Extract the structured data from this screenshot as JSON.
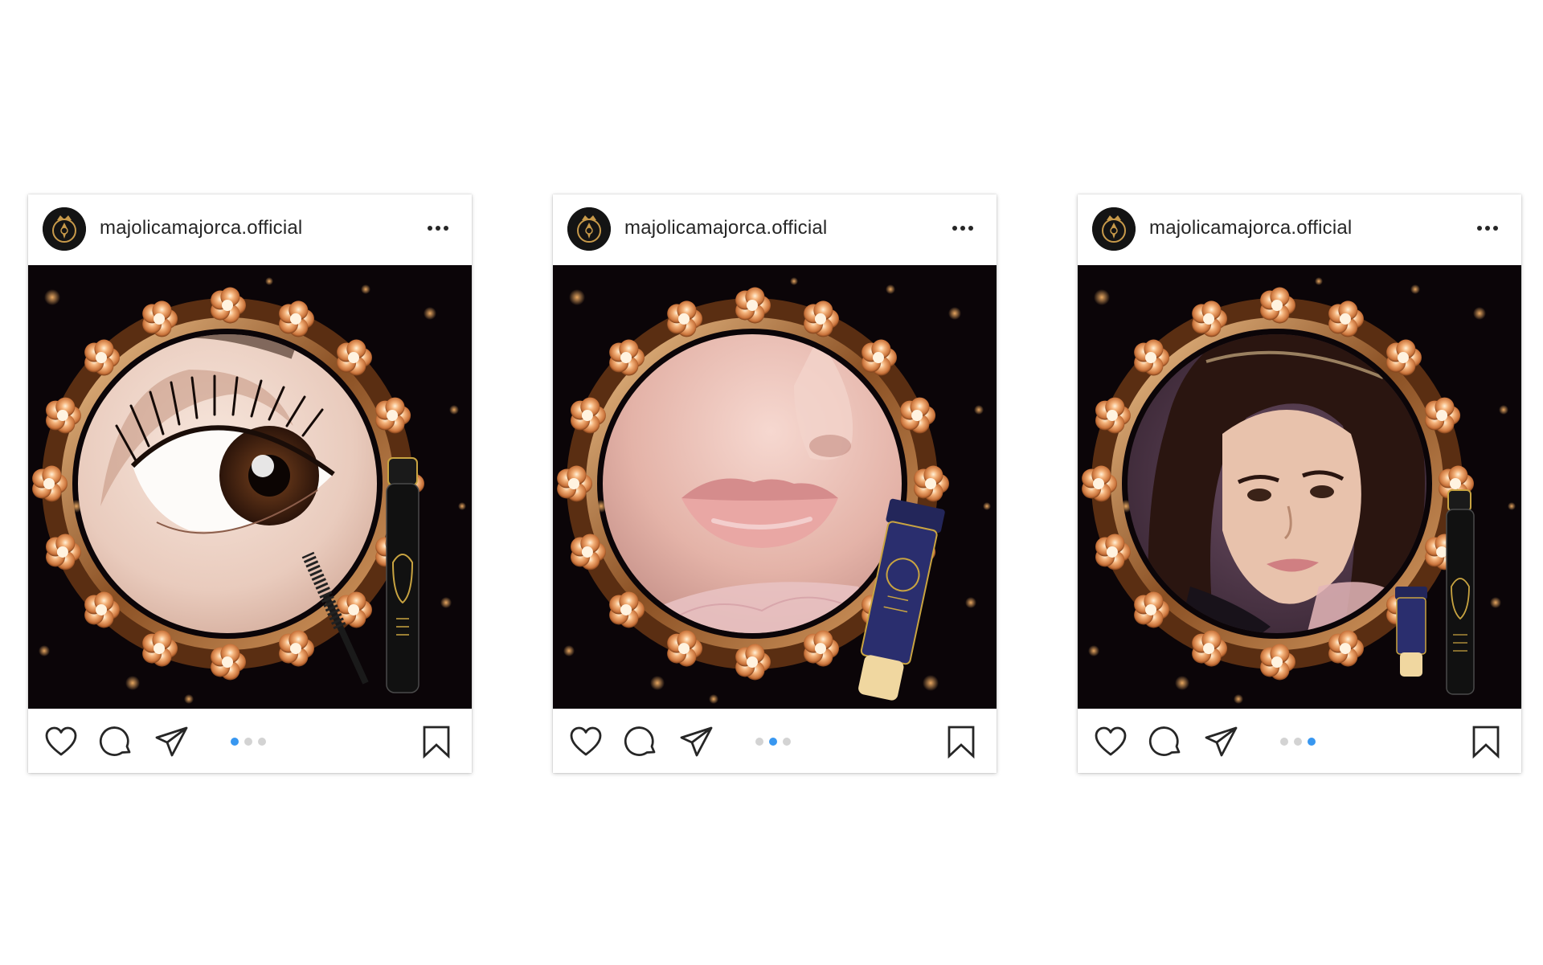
{
  "colors": {
    "active_dot": "#3897f0",
    "inactive_dot": "#d3d3d3",
    "frame_gold": "#d9955b",
    "photo_bg": "#0b0508"
  },
  "posts": [
    {
      "username": "majolicamajorca.official",
      "icons": [
        "brand-crest-icon",
        "more-options-icon",
        "heart-icon",
        "comment-icon",
        "share-icon",
        "bookmark-icon"
      ],
      "carousel": {
        "current": 1,
        "total": 3
      },
      "photo": {
        "subject": "eye-closeup",
        "product": "mascara"
      }
    },
    {
      "username": "majolicamajorca.official",
      "icons": [
        "brand-crest-icon",
        "more-options-icon",
        "heart-icon",
        "comment-icon",
        "share-icon",
        "bookmark-icon"
      ],
      "carousel": {
        "current": 2,
        "total": 3
      },
      "photo": {
        "subject": "lips-closeup",
        "product": "lip-tube"
      }
    },
    {
      "username": "majolicamajorca.official",
      "icons": [
        "brand-crest-icon",
        "more-options-icon",
        "heart-icon",
        "comment-icon",
        "share-icon",
        "bookmark-icon"
      ],
      "carousel": {
        "current": 3,
        "total": 3
      },
      "photo": {
        "subject": "model-portrait",
        "product": "mascara-and-tube"
      }
    }
  ]
}
